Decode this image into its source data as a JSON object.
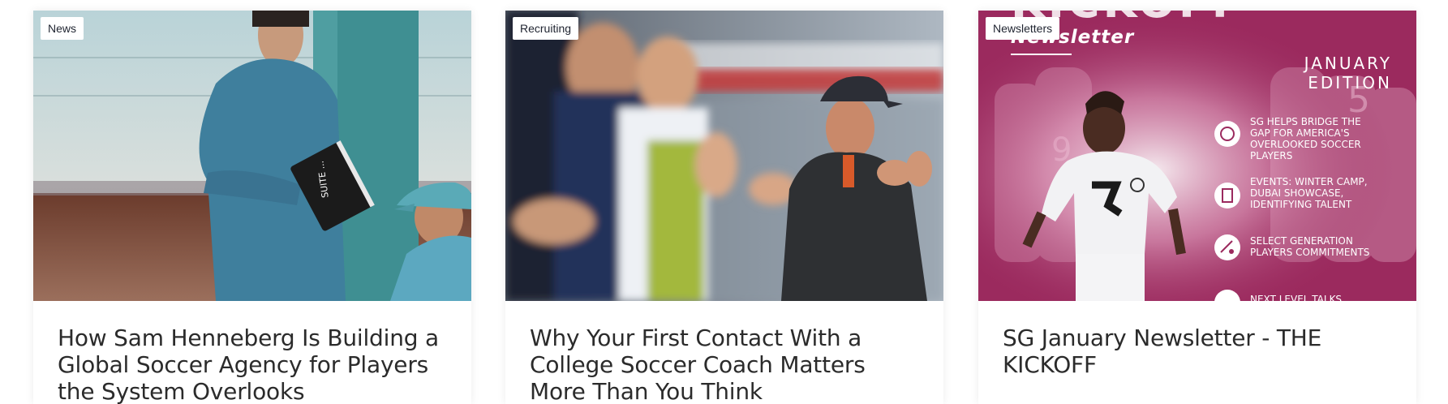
{
  "cards": [
    {
      "category": "News",
      "title": "How Sam Henneberg Is Building a Global Soccer Agency for Players the System Overlooks",
      "image_alt": "Coach holding a notebook standing beside a post on a soccer field",
      "book_text": "SUITE ..."
    },
    {
      "category": "Recruiting",
      "title": "Why Your First Contact With a College Soccer Coach Matters More Than You Think",
      "image_alt": "College soccer coach clapping on the sideline with players in foreground"
    },
    {
      "category": "Newsletters",
      "title": "SG January Newsletter - THE KICKOFF",
      "image_alt": "January edition newsletter graphic with a soccer player",
      "newsletter": {
        "headline": "KICKOFF",
        "subhead": "Newsletter",
        "edition_line1": "JANUARY",
        "edition_line2": "EDITION",
        "items": [
          {
            "icon": "soccer-ball-icon",
            "lines": [
              "SG HELPS BRIDGE THE",
              "GAP FOR AMERICA'S",
              "OVERLOOKED SOCCER",
              "PLAYERS"
            ]
          },
          {
            "icon": "document-icon",
            "lines": [
              "EVENTS: WINTER CAMP,",
              "DUBAI SHOWCASE,",
              "IDENTIFYING TALENT"
            ]
          },
          {
            "icon": "kick-icon",
            "lines": [
              "SELECT GENERATION",
              "PLAYERS COMMITMENTS"
            ]
          },
          {
            "icon": "chat-icon",
            "lines": [
              "NEXT LEVEL TALKS"
            ]
          }
        ],
        "jersey_numbers": [
          "5",
          "9"
        ]
      }
    }
  ],
  "colors": {
    "badge_bg": "#ffffff",
    "badge_text": "#1f2430",
    "title_text": "#2b2b2b",
    "newsletter_magenta": "#9b2a5e"
  }
}
